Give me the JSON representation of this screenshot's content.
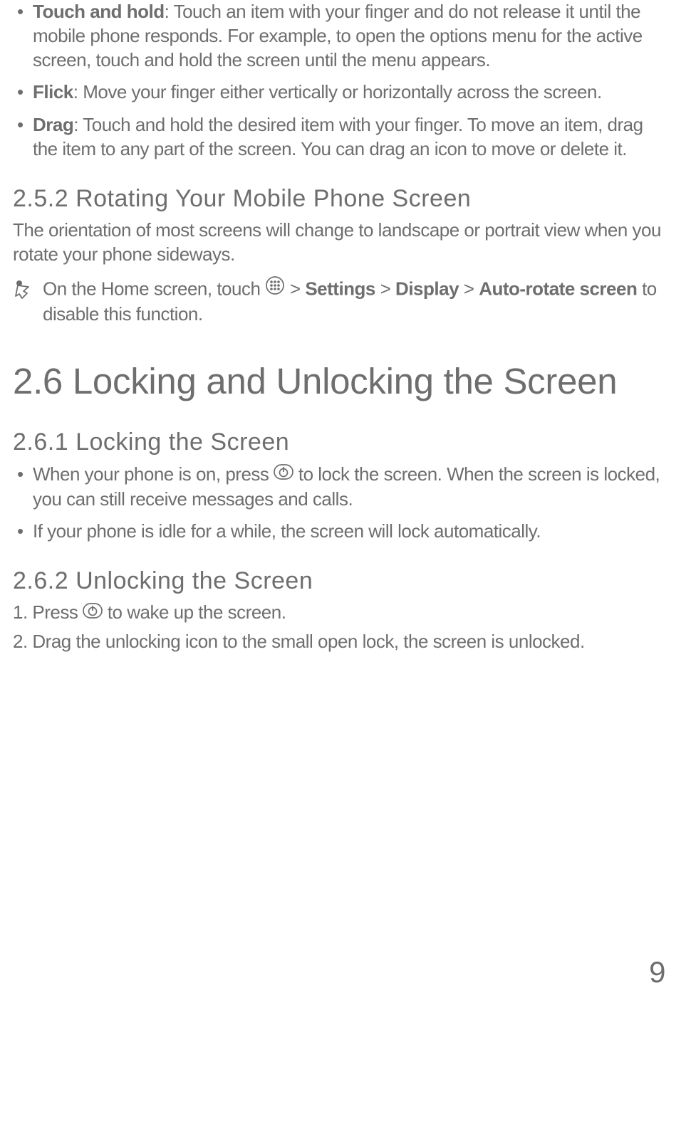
{
  "gestures": [
    {
      "term": "Touch and hold",
      "desc": ": Touch an item with your finger and do not release it until the mobile phone responds. For example, to open the options menu for the active screen, touch and hold the screen until the menu appears."
    },
    {
      "term": "Flick",
      "desc": ": Move your finger either vertically or horizontally across the screen."
    },
    {
      "term": "Drag",
      "desc": ": Touch and hold the desired item with your finger. To move an item, drag the item to any part of the screen. You can drag an icon to move or delete it."
    }
  ],
  "s252": {
    "heading": "2.5.2  Rotating Your Mobile Phone Screen",
    "body": "The orientation of most screens will change to landscape or portrait view when you rotate your phone sideways.",
    "note_pre": "On the Home screen, touch ",
    "note_gt1": " > ",
    "note_settings": "Settings",
    "note_gt2": " > ",
    "note_display": "Display",
    "note_gt3": " > ",
    "note_auto": "Auto-rotate screen",
    "note_post": " to disable this function."
  },
  "s26": {
    "heading": "2.6  Locking and Unlocking the Screen"
  },
  "s261": {
    "heading": "2.6.1  Locking the Screen",
    "b1_pre": "When your phone is on, press ",
    "b1_post": " to lock the screen. When the screen is locked, you can still receive messages and calls.",
    "b2": "If your phone is idle for a while, the screen will lock automatically."
  },
  "s262": {
    "heading": "2.6.2  Unlocking the Screen",
    "step1_pre": "1. Press ",
    "step1_post": " to wake up the screen.",
    "step2": "2. Drag the unlocking icon to the small open lock, the screen is unlocked."
  },
  "page_number": "9"
}
